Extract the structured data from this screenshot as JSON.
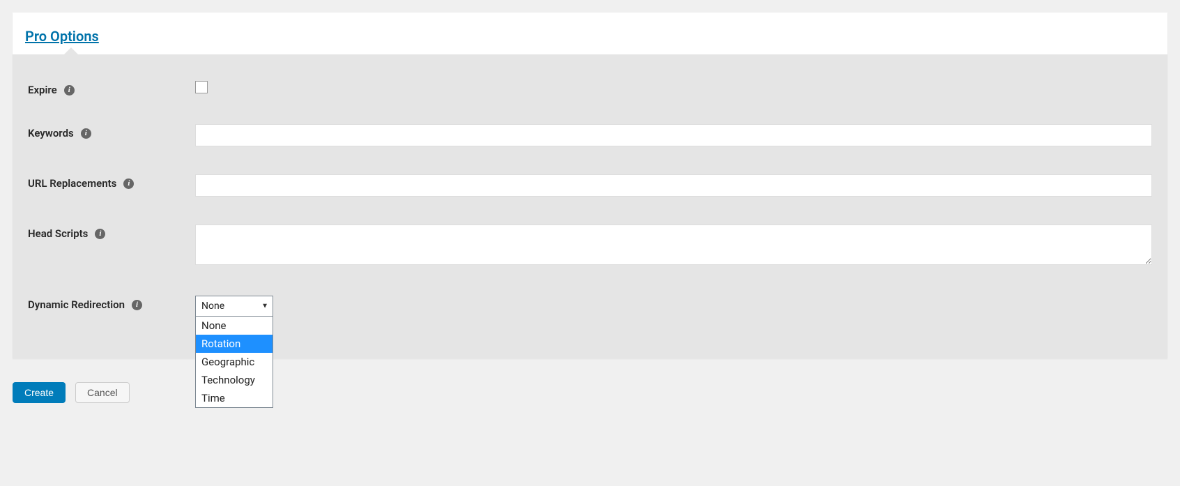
{
  "header": {
    "title": "Pro Options"
  },
  "fields": {
    "expire": {
      "label": "Expire",
      "checked": false
    },
    "keywords": {
      "label": "Keywords",
      "value": ""
    },
    "url_replacements": {
      "label": "URL Replacements",
      "value": ""
    },
    "head_scripts": {
      "label": "Head Scripts",
      "value": ""
    },
    "dynamic_redirection": {
      "label": "Dynamic Redirection",
      "selected": "None",
      "options": [
        "None",
        "Rotation",
        "Geographic",
        "Technology",
        "Time"
      ],
      "highlighted_index": 1
    }
  },
  "buttons": {
    "create": "Create",
    "cancel": "Cancel"
  },
  "icons": {
    "info_glyph": "i"
  }
}
